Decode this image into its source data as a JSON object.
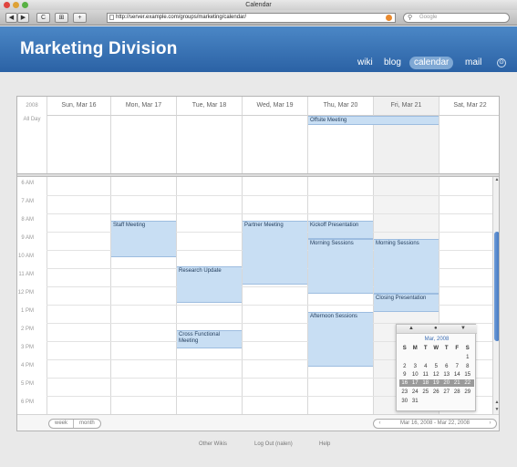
{
  "window": {
    "title": "Calendar"
  },
  "toolbar": {
    "back": "◀",
    "forward": "▶",
    "reload": "C",
    "bookmark": "⊞",
    "add": "+",
    "url": "http://server.example.com/groups/marketing/calendar/",
    "search_placeholder": "Google"
  },
  "header": {
    "title": "Marketing Division",
    "nav": [
      "wiki",
      "blog",
      "calendar",
      "mail"
    ],
    "active_nav": "calendar"
  },
  "calendar": {
    "year": "2008",
    "all_day_label": "All Day",
    "days": [
      "Sun, Mar 16",
      "Mon, Mar 17",
      "Tue, Mar 18",
      "Wed, Mar 19",
      "Thu, Mar 20",
      "Fri, Mar 21",
      "Sat, Mar 22"
    ],
    "hours": [
      "6 AM",
      "7 AM",
      "8 AM",
      "9 AM",
      "10 AM",
      "11 AM",
      "12 PM",
      "1 PM",
      "2 PM",
      "3 PM",
      "4 PM",
      "5 PM",
      "6 PM"
    ],
    "all_day_events": [
      {
        "title": "Offsite Meeting"
      }
    ],
    "events": [
      {
        "title": "Staff Meeting"
      },
      {
        "title": "Research Update"
      },
      {
        "title": "Cross Functional Meeting"
      },
      {
        "title": "Partner Meeting"
      },
      {
        "title": "Kickoff Presentation"
      },
      {
        "title": "Morning Sessions"
      },
      {
        "title": "Afternoon Sessions"
      },
      {
        "title": "Morning Sessions"
      },
      {
        "title": "Closing Presentation"
      }
    ],
    "view_week": "week",
    "view_month": "month",
    "date_range": "Mar 16, 2008 - Mar 22, 2008"
  },
  "mini_calendar": {
    "month": "Mar, 2008",
    "weekdays": [
      "S",
      "M",
      "T",
      "W",
      "T",
      "F",
      "S"
    ],
    "weeks": [
      [
        "",
        "",
        "",
        "",
        "",
        "",
        "1"
      ],
      [
        "2",
        "3",
        "4",
        "5",
        "6",
        "7",
        "8"
      ],
      [
        "9",
        "10",
        "11",
        "12",
        "13",
        "14",
        "15"
      ],
      [
        "16",
        "17",
        "18",
        "19",
        "20",
        "21",
        "22"
      ],
      [
        "23",
        "24",
        "25",
        "26",
        "27",
        "28",
        "29"
      ],
      [
        "30",
        "31",
        "",
        "",
        "",
        "",
        ""
      ]
    ],
    "highlighted_week": 3
  },
  "footer": {
    "links": [
      "Other Wikis",
      "Log Out (nalen)",
      "Help"
    ]
  },
  "colors": {
    "header_blue": "#3a74b8",
    "event_fill": "#c8def3",
    "scroll_thumb": "#4a80c8"
  }
}
